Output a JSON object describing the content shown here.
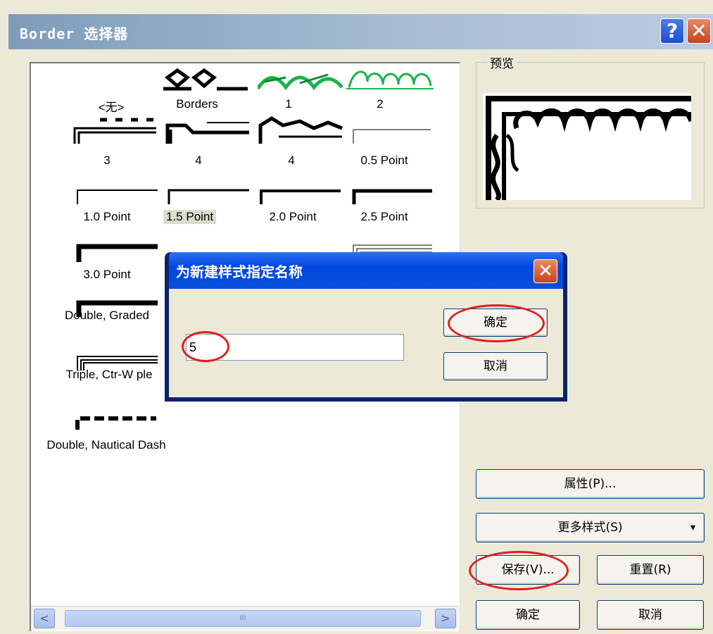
{
  "window": {
    "title": "Border  选择器",
    "help_label": "?",
    "close_label": "✕"
  },
  "borders": [
    {
      "label": "<无>"
    },
    {
      "label": "Borders"
    },
    {
      "label": "1"
    },
    {
      "label": "2"
    },
    {
      "label": "3"
    },
    {
      "label": "4"
    },
    {
      "label": "4"
    },
    {
      "label": "0.5 Point"
    },
    {
      "label": "1.0 Point"
    },
    {
      "label": "1.5 Point",
      "selected": true
    },
    {
      "label": "2.0 Point"
    },
    {
      "label": "2.5 Point"
    },
    {
      "label": "3.0 Point"
    },
    {
      "label": "Double, Graded"
    },
    {
      "label": "Triple, Ctr-W ple"
    },
    {
      "label": "Double, Nautical Dash"
    }
  ],
  "scrollbar": {
    "left_arrow": "<",
    "right_arrow": ">",
    "thumb_grip": "III"
  },
  "preview": {
    "label": "预览"
  },
  "buttons": {
    "properties": "属性(P)...",
    "more_styles": "更多样式(S)",
    "more_styles_arrow": "▾",
    "save": "保存(V)...",
    "reset": "重置(R)",
    "ok": "确定",
    "cancel": "取消"
  },
  "dialog": {
    "title": "为新建样式指定名称",
    "close_label": "✕",
    "name_value": "5",
    "ok": "确定",
    "cancel": "取消"
  },
  "colors": {
    "annotation": "#e02020",
    "xp_blue": "#0a4fd8",
    "selected_bg": "#dcdccc"
  }
}
